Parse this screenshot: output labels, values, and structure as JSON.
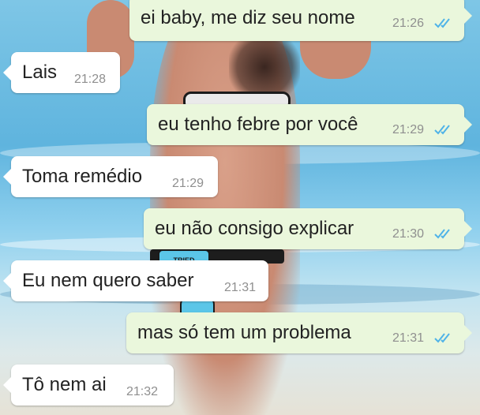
{
  "colors": {
    "outgoing_bubble": "#eaf7dc",
    "incoming_bubble": "#ffffff",
    "timestamp": "#8f8f8f",
    "read_check": "#4fb3e8"
  },
  "background": {
    "swimsuit_tag": "TRIED"
  },
  "messages": [
    {
      "direction": "out",
      "text": "ei baby, me diz seu nome",
      "time": "21:26",
      "status_icon": "double-check-read-icon"
    },
    {
      "direction": "in",
      "text": "Lais",
      "time": "21:28"
    },
    {
      "direction": "out",
      "text": "eu tenho febre por você",
      "time": "21:29",
      "status_icon": "double-check-read-icon"
    },
    {
      "direction": "in",
      "text": "Toma remédio",
      "time": "21:29"
    },
    {
      "direction": "out",
      "text": "eu não consigo explicar",
      "time": "21:30",
      "status_icon": "double-check-read-icon"
    },
    {
      "direction": "in",
      "text": "Eu nem quero saber",
      "time": "21:31"
    },
    {
      "direction": "out",
      "text": "mas só tem um problema",
      "time": "21:31",
      "status_icon": "double-check-read-icon"
    },
    {
      "direction": "in",
      "text": "Tô nem ai",
      "time": "21:32"
    }
  ]
}
